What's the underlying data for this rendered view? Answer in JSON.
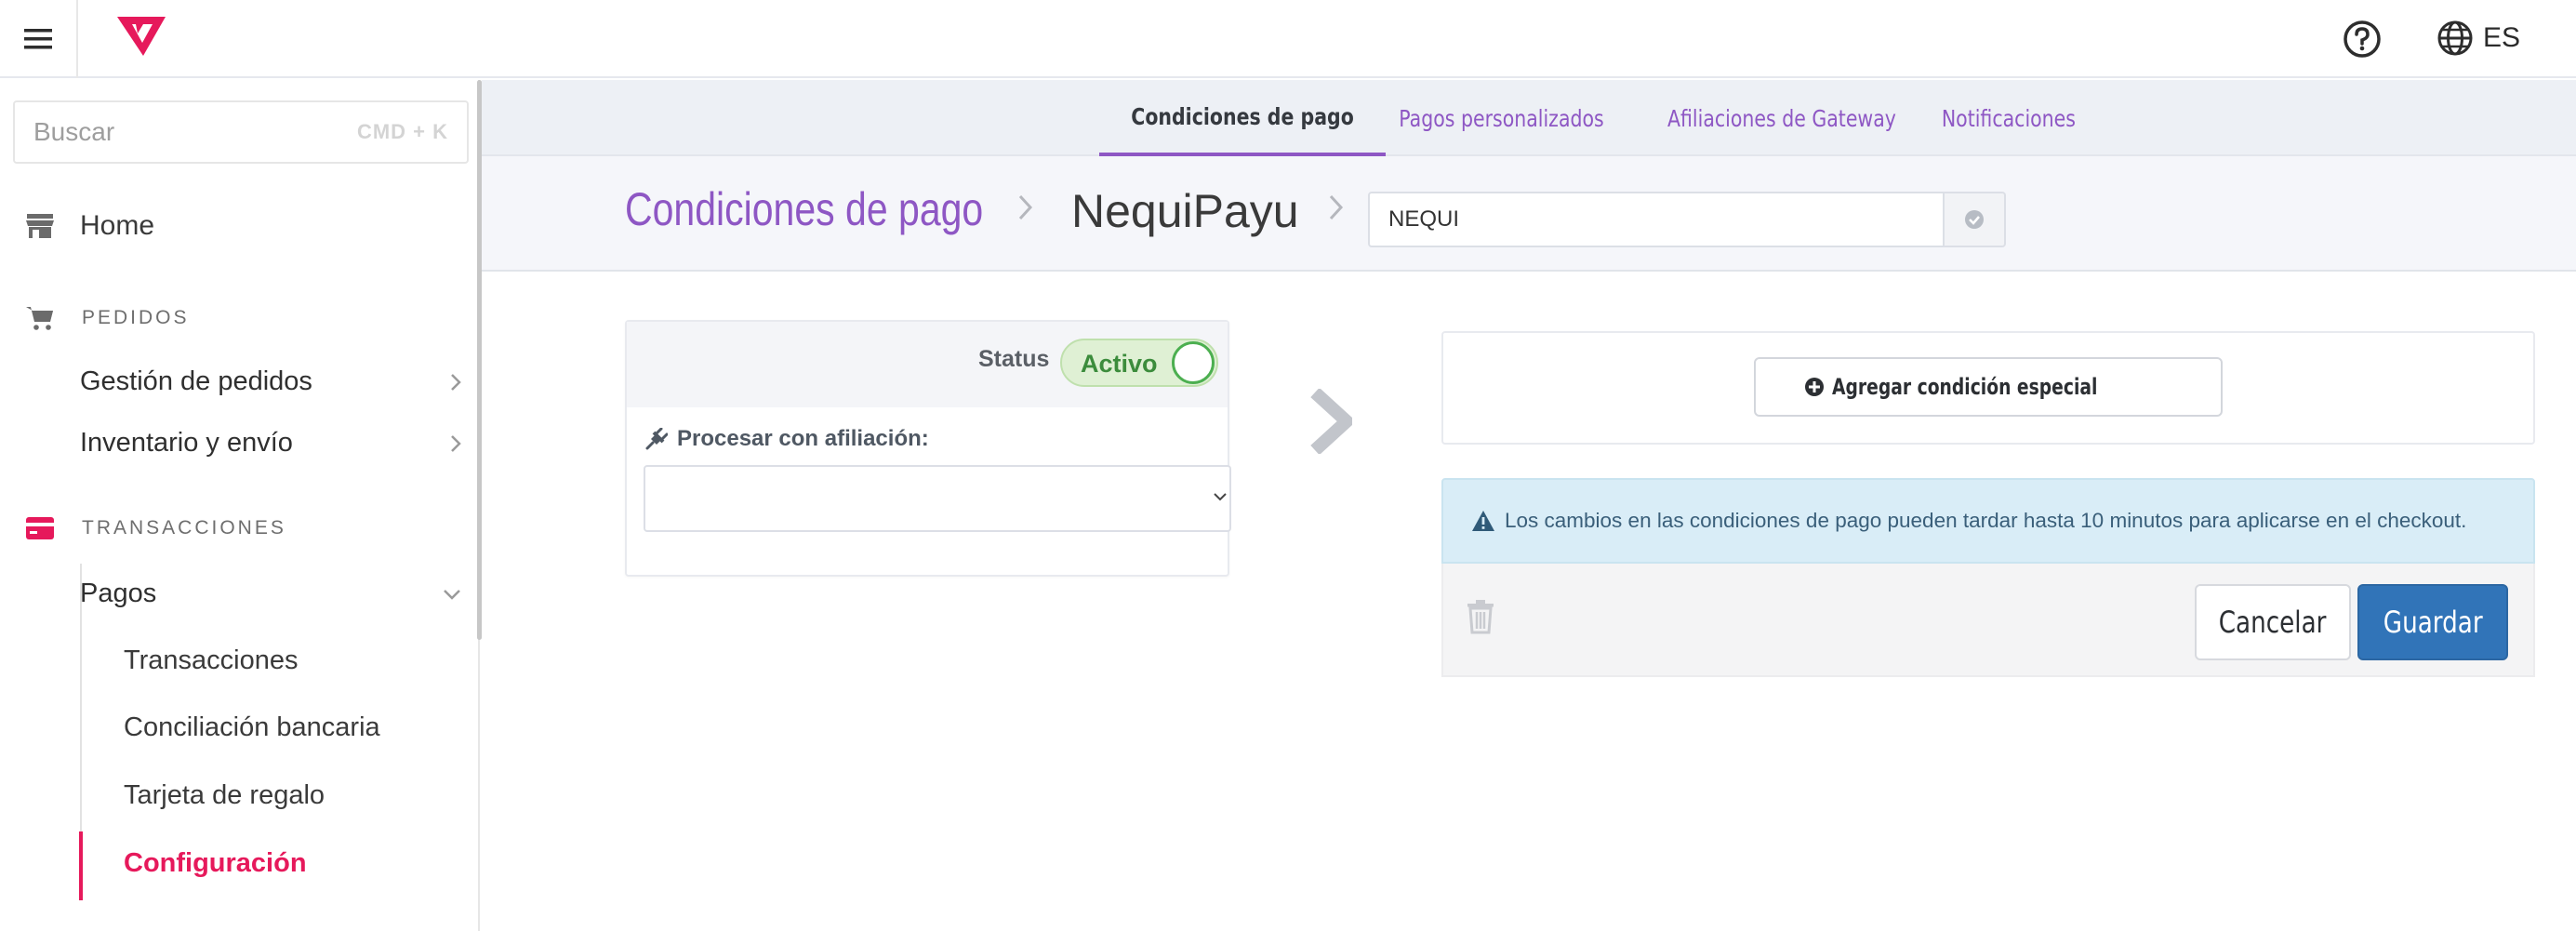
{
  "topbar": {
    "menu_icon": "hamburger-icon",
    "logo_icon": "brand-logo-icon",
    "help_icon": "question-circle-icon",
    "language_icon": "globe-icon",
    "language": "ES"
  },
  "sidebar": {
    "search": {
      "placeholder": "Buscar",
      "shortcut": "CMD + K"
    },
    "home": {
      "label": "Home",
      "icon": "store-icon"
    },
    "sections": [
      {
        "title": "PEDIDOS",
        "icon": "cart-icon",
        "items": [
          {
            "label": "Gestión de pedidos"
          },
          {
            "label": "Inventario y envío"
          }
        ]
      },
      {
        "title": "TRANSACCIONES",
        "icon": "credit-card-icon",
        "items": [
          {
            "label": "Pagos",
            "expanded": true,
            "children": [
              {
                "label": "Transacciones"
              },
              {
                "label": "Conciliación bancaria"
              },
              {
                "label": "Tarjeta de regalo"
              },
              {
                "label": "Configuración",
                "active": true
              }
            ]
          }
        ]
      }
    ]
  },
  "tabs": [
    {
      "label": "Condiciones de pago",
      "active": true
    },
    {
      "label": "Pagos personalizados"
    },
    {
      "label": "Afiliaciones de Gateway"
    },
    {
      "label": "Notificaciones"
    }
  ],
  "breadcrumb": {
    "root": "Condiciones de pago",
    "current": "NequiPayu",
    "name_value": "NEQUI"
  },
  "rule_card": {
    "status_label": "Status",
    "status_value": "Activo",
    "process_label": "Procesar con afiliación:",
    "process_icon": "plug-icon",
    "process_value": ""
  },
  "special_conditions": {
    "add_button": "Agregar condición especial"
  },
  "alert": {
    "icon": "warning-triangle-icon",
    "text": "Los cambios en las condiciones de pago pueden tardar hasta 10 minutos para aplicarse en el checkout."
  },
  "actions": {
    "delete_icon": "trash-icon",
    "cancel": "Cancelar",
    "save": "Guardar"
  },
  "colors": {
    "brand": "#e6195b",
    "accent_purple": "#8e57c4",
    "primary_button": "#3174b8",
    "status_active": "#4caf50",
    "alert_bg": "#d9edf7"
  }
}
